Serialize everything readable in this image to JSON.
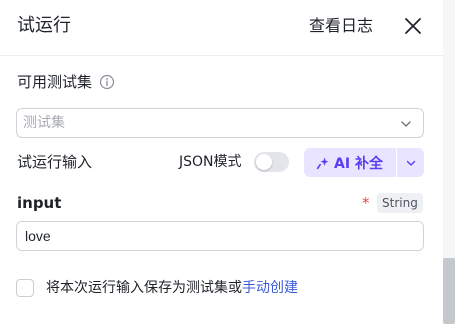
{
  "header": {
    "title": "试运行",
    "view_log_label": "查看日志",
    "close_icon": "close-icon"
  },
  "test_set": {
    "label": "可用测试集",
    "info_icon": "info-icon",
    "placeholder": "测试集"
  },
  "run_input": {
    "label": "试运行输入",
    "json_mode_label": "JSON模式",
    "json_mode_on": false,
    "ai_fill_label": "AI 补全",
    "accent_color": "#5b3cf2"
  },
  "field": {
    "name": "input",
    "required_mark": "*",
    "type": "String",
    "value": "love"
  },
  "save": {
    "text": "将本次运行输入保存为测试集或",
    "link": "手动创建",
    "checked": false
  }
}
